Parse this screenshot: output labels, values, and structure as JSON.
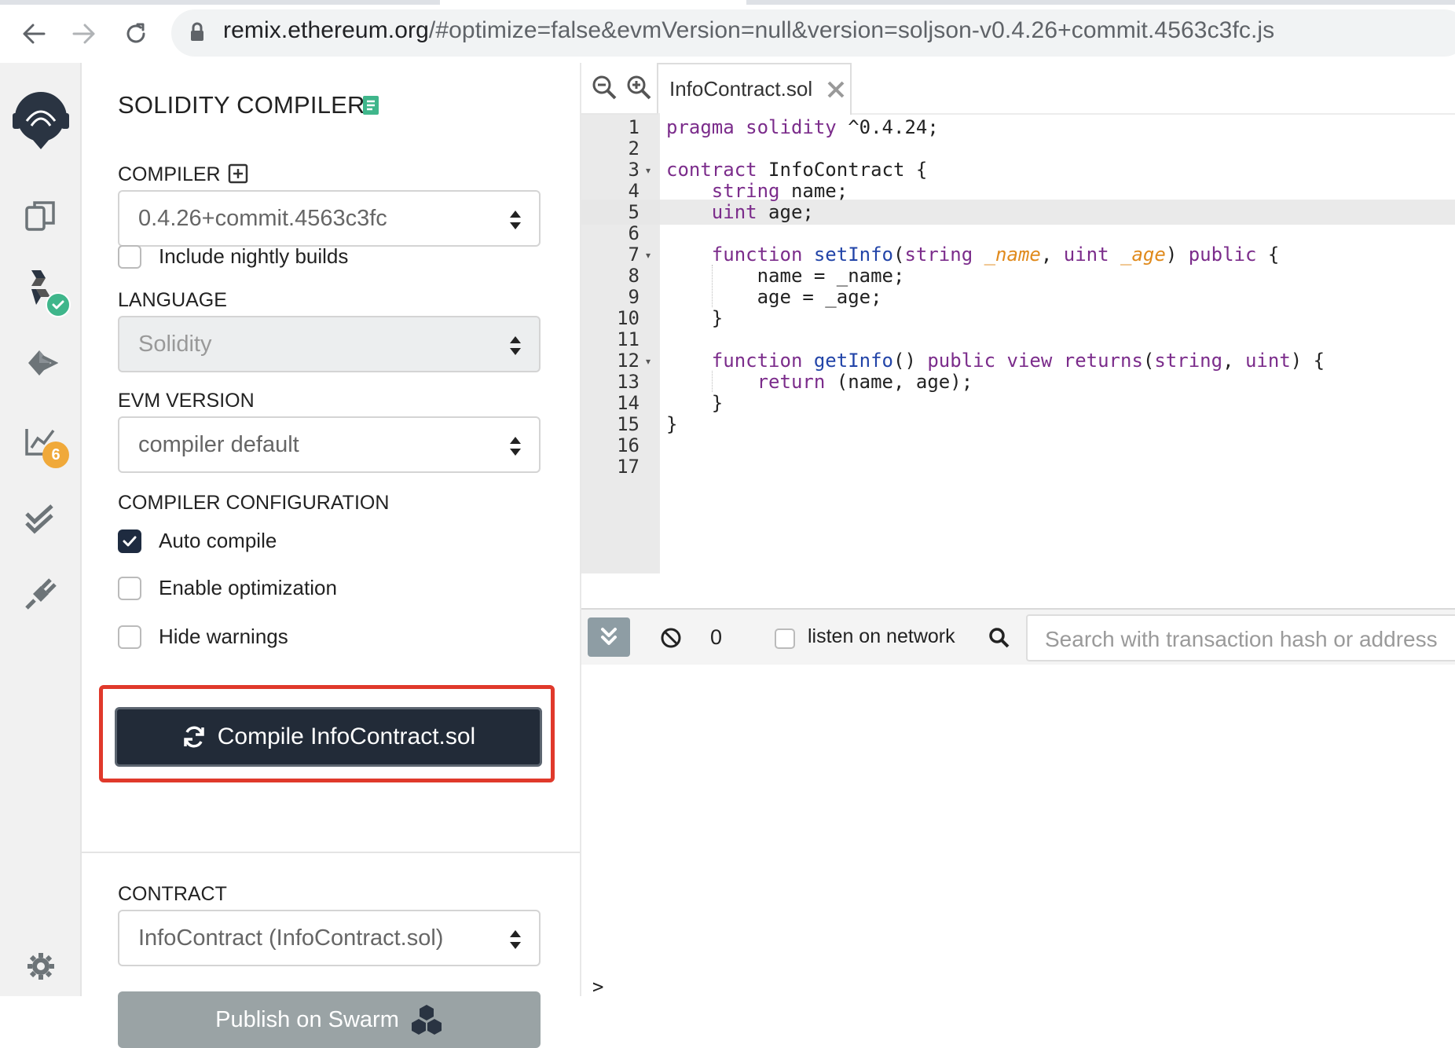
{
  "browser": {
    "url_host": "remix.ethereum.org",
    "url_rest": "/#optimize=false&evmVersion=null&version=soljson-v0.4.26+commit.4563c3fc.js"
  },
  "icon_rail": {
    "items": [
      {
        "name": "remix-logo-icon"
      },
      {
        "name": "file-explorer-icon"
      },
      {
        "name": "solidity-compiler-icon"
      },
      {
        "name": "deploy-run-icon"
      },
      {
        "name": "analysis-icon",
        "badge": "6"
      },
      {
        "name": "testing-icon"
      },
      {
        "name": "plugin-manager-icon"
      },
      {
        "name": "settings-gear-icon"
      }
    ],
    "colors": {
      "check_badge": "#3fb68b",
      "count_badge": "#f0a93a"
    }
  },
  "compiler_panel": {
    "title": "SOLIDITY COMPILER",
    "compiler_label": "COMPILER",
    "compiler_value": "0.4.26+commit.4563c3fc",
    "nightly_label": "Include nightly builds",
    "nightly_checked": false,
    "language_label": "LANGUAGE",
    "language_value": "Solidity",
    "evm_label": "EVM VERSION",
    "evm_value": "compiler default",
    "config_label": "COMPILER CONFIGURATION",
    "auto_compile_label": "Auto compile",
    "auto_compile_checked": true,
    "optimization_label": "Enable optimization",
    "optimization_checked": false,
    "hide_warnings_label": "Hide warnings",
    "hide_warnings_checked": false,
    "compile_button": "Compile InfoContract.sol",
    "contract_label": "CONTRACT",
    "contract_value": "InfoContract (InfoContract.sol)",
    "publish_button": "Publish on Swarm",
    "colors": {
      "compile_bg": "#222b38",
      "highlight_border": "#e0392b",
      "publish_bg": "#9aa3a5"
    }
  },
  "editor": {
    "file_tab": "InfoContract.sol",
    "active_line": 5,
    "line_numbers": [
      "1",
      "2",
      "3",
      "4",
      "5",
      "6",
      "7",
      "8",
      "9",
      "10",
      "11",
      "12",
      "13",
      "14",
      "15",
      "16",
      "17"
    ],
    "lines": [
      [
        {
          "t": "pragma solidity",
          "c": "kw"
        },
        {
          "t": " ^0.4.24;",
          "c": ""
        }
      ],
      [],
      [
        {
          "t": "contract",
          "c": "kw"
        },
        {
          "t": " InfoContract {",
          "c": ""
        }
      ],
      [
        {
          "t": "    ",
          "c": ""
        },
        {
          "t": "string",
          "c": "ty"
        },
        {
          "t": " name;",
          "c": ""
        }
      ],
      [
        {
          "t": "    ",
          "c": ""
        },
        {
          "t": "uint",
          "c": "ty"
        },
        {
          "t": " age;",
          "c": ""
        }
      ],
      [],
      [
        {
          "t": "    ",
          "c": ""
        },
        {
          "t": "function",
          "c": "kw"
        },
        {
          "t": " ",
          "c": ""
        },
        {
          "t": "setInfo",
          "c": "fn"
        },
        {
          "t": "(",
          "c": ""
        },
        {
          "t": "string",
          "c": "ty"
        },
        {
          "t": " ",
          "c": ""
        },
        {
          "t": "_name",
          "c": "pm"
        },
        {
          "t": ", ",
          "c": ""
        },
        {
          "t": "uint",
          "c": "ty"
        },
        {
          "t": " ",
          "c": ""
        },
        {
          "t": "_age",
          "c": "pm"
        },
        {
          "t": ") ",
          "c": ""
        },
        {
          "t": "public",
          "c": "kw"
        },
        {
          "t": " {",
          "c": ""
        }
      ],
      [
        {
          "t": "        name = _name;",
          "c": ""
        }
      ],
      [
        {
          "t": "        age = _age;",
          "c": ""
        }
      ],
      [
        {
          "t": "    }",
          "c": ""
        }
      ],
      [],
      [
        {
          "t": "    ",
          "c": ""
        },
        {
          "t": "function",
          "c": "kw"
        },
        {
          "t": " ",
          "c": ""
        },
        {
          "t": "getInfo",
          "c": "fn"
        },
        {
          "t": "() ",
          "c": ""
        },
        {
          "t": "public view returns",
          "c": "kw"
        },
        {
          "t": "(",
          "c": ""
        },
        {
          "t": "string",
          "c": "ty"
        },
        {
          "t": ", ",
          "c": ""
        },
        {
          "t": "uint",
          "c": "ty"
        },
        {
          "t": ") {",
          "c": ""
        }
      ],
      [
        {
          "t": "        ",
          "c": ""
        },
        {
          "t": "return",
          "c": "kw"
        },
        {
          "t": " (name, age);",
          "c": ""
        }
      ],
      [
        {
          "t": "    }",
          "c": ""
        }
      ],
      [
        {
          "t": "}",
          "c": ""
        }
      ],
      [],
      []
    ],
    "fold_lines": [
      3,
      7,
      12
    ]
  },
  "terminal": {
    "count": "0",
    "listen_label": "listen on network",
    "listen_checked": false,
    "search_placeholder": "Search with transaction hash or address",
    "prompt": ">"
  }
}
